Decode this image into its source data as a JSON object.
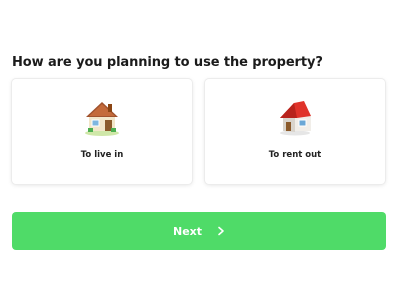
{
  "question": "How are you planning to use the property?",
  "options": [
    {
      "label": "To live in",
      "icon": "house-with-garden-icon"
    },
    {
      "label": "To rent out",
      "icon": "red-roof-house-icon"
    }
  ],
  "next_button": {
    "label": "Next",
    "icon": "chevron-right-icon"
  },
  "colors": {
    "accent": "#4fdb68",
    "roof_brown": "#a0522d",
    "roof_red": "#e0332a"
  }
}
